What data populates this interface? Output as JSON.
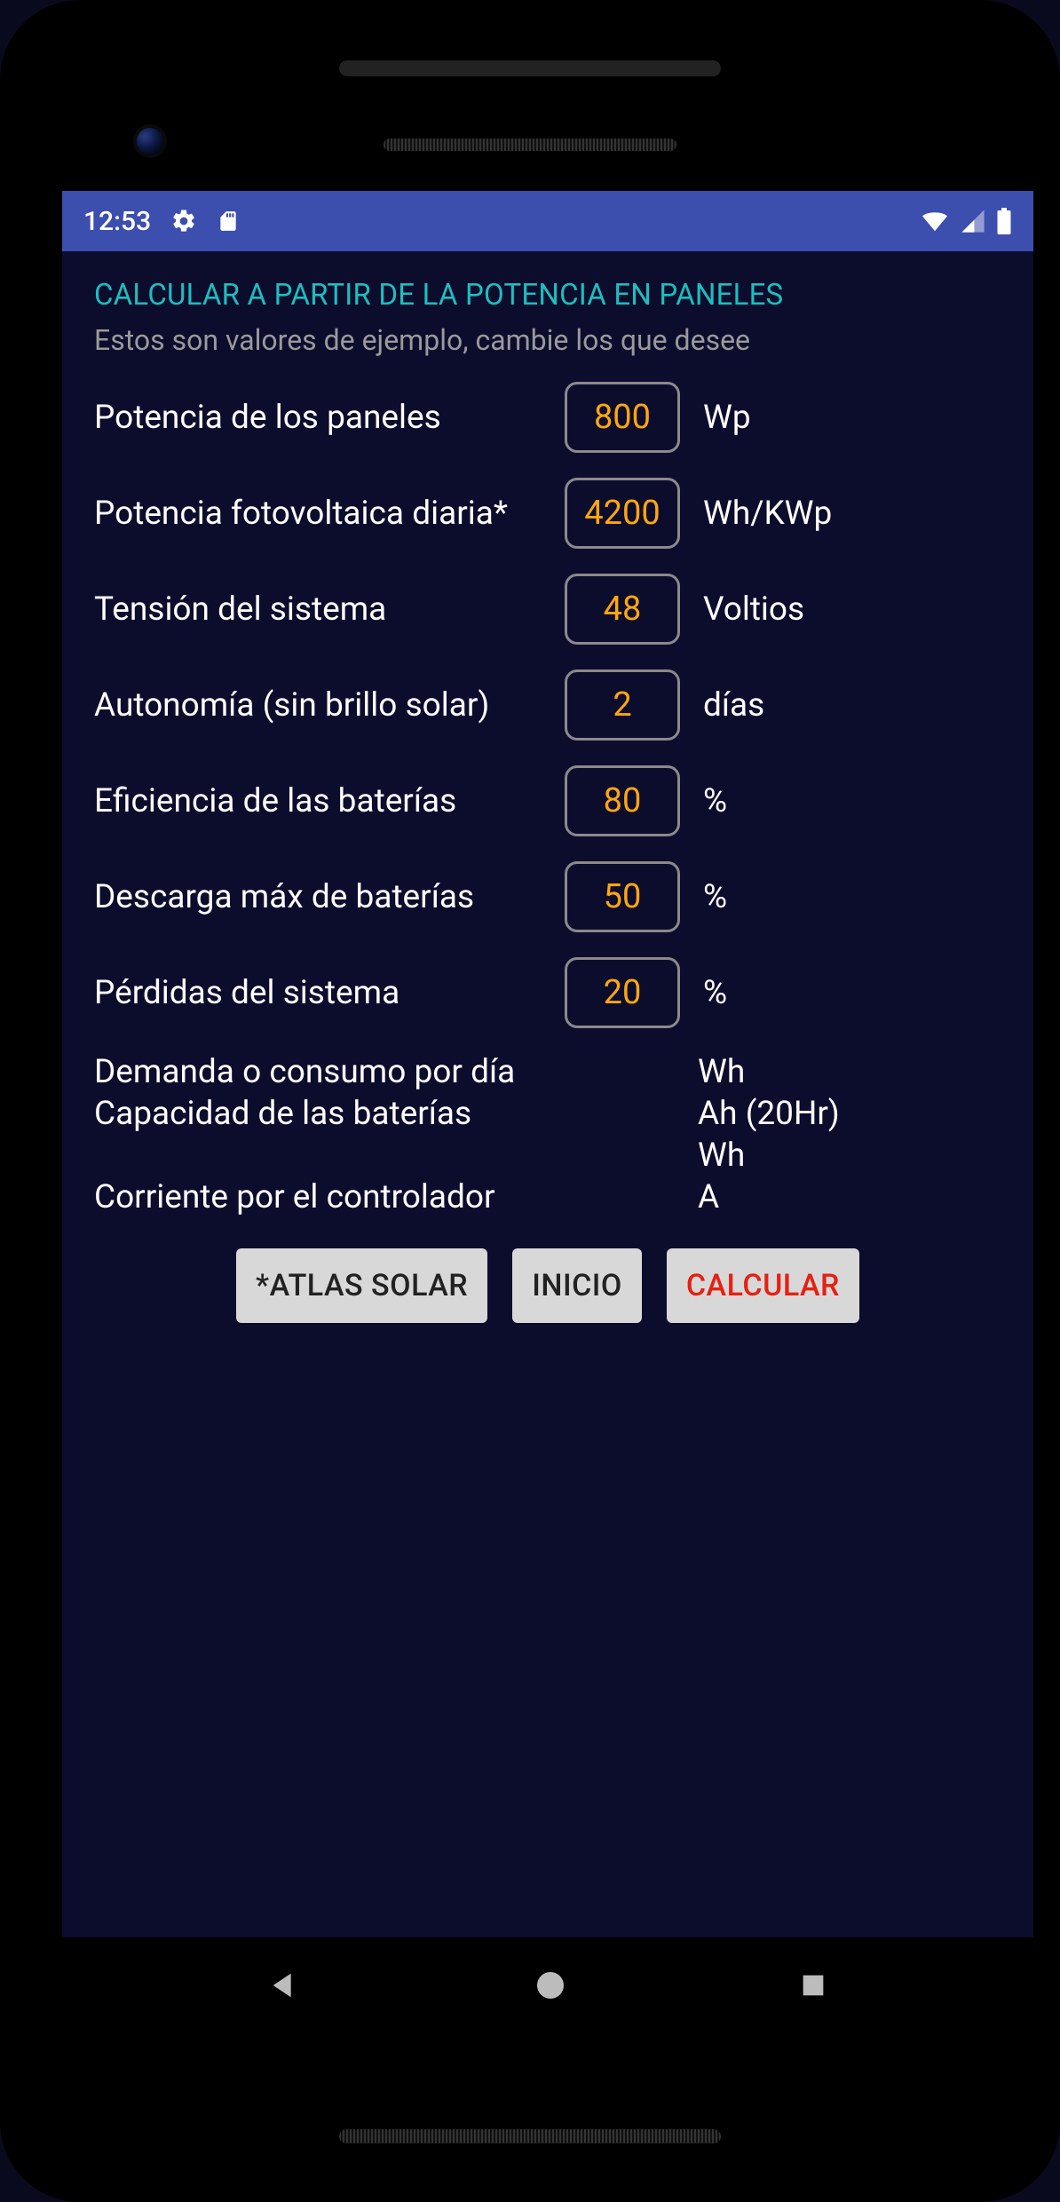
{
  "status": {
    "time": "12:53"
  },
  "page": {
    "title": "CALCULAR A PARTIR DE LA POTENCIA EN PANELES",
    "subtitle": "Estos son valores de ejemplo, cambie los que desee"
  },
  "inputs": [
    {
      "label": "Potencia de los paneles",
      "value": "800",
      "unit": "Wp"
    },
    {
      "label": "Potencia fotovoltaica diaria*",
      "value": "4200",
      "unit": "Wh/KWp"
    },
    {
      "label": "Tensión del sistema",
      "value": "48",
      "unit": "Voltios"
    },
    {
      "label": "Autonomía (sin brillo solar)",
      "value": "2",
      "unit": "días"
    },
    {
      "label": "Eficiencia de las baterías",
      "value": "80",
      "unit": "%"
    },
    {
      "label": "Descarga máx de baterías",
      "value": "50",
      "unit": "%"
    },
    {
      "label": "Pérdidas del sistema",
      "value": "20",
      "unit": "%"
    }
  ],
  "outputs": [
    {
      "label": "Demanda o consumo por día",
      "unit": "Wh"
    },
    {
      "label": "Capacidad de las baterías",
      "unit": "Ah (20Hr)"
    },
    {
      "label": "",
      "unit": "Wh"
    },
    {
      "label": "Corriente por el controlador",
      "unit": "A"
    }
  ],
  "buttons": {
    "atlas": "*ATLAS SOLAR",
    "home": "INICIO",
    "calc": "CALCULAR"
  }
}
